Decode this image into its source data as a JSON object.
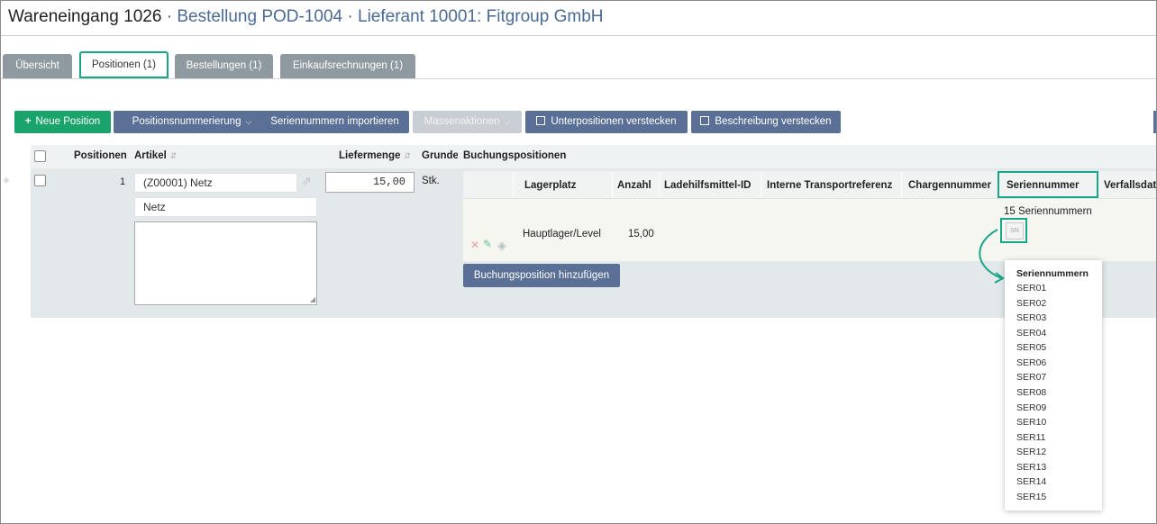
{
  "header": {
    "title_main": "Wareneingang 1026",
    "separator": "·",
    "link_order": "Bestellung POD-1004",
    "link_supplier": "Lieferant 10001: Fitgroup GmbH"
  },
  "tabs": [
    {
      "label": "Übersicht"
    },
    {
      "label": "Positionen (1)"
    },
    {
      "label": "Bestellungen (1)"
    },
    {
      "label": "Einkaufsrechnungen (1)"
    }
  ],
  "toolbar": {
    "new_position": "Neue Position",
    "numbering": "Positionsnummerierung",
    "import_serials": "Seriennummern importieren",
    "mass_actions": "Massenaktionen",
    "hide_subpositions": "Unterpositionen verstecken",
    "hide_description": "Beschreibung verstecken"
  },
  "table": {
    "headers": {
      "positions": "Positionen",
      "article": "Artikel",
      "quantity": "Liefermenge",
      "unit": "Grundeinheit",
      "bookings": "Buchungspositionen"
    },
    "row": {
      "number": "1",
      "article_value": "(Z00001) Netz",
      "article_name": "Netz",
      "quantity_value": "15,00",
      "unit": "Stk."
    }
  },
  "subtable": {
    "headers": [
      "Lagerplatz",
      "Anzahl",
      "Ladehilfsmittel-ID",
      "Interne Transportreferenz",
      "Chargennummer",
      "Seriennummer",
      "Verfallsdatum"
    ],
    "row": {
      "location": "Hauptlager/Level",
      "count": "15,00",
      "serial_summary": "15 Seriennummern",
      "serial_icon_label": "SN"
    },
    "add_button": "Buchungsposition hinzufügen"
  },
  "serial_popup": {
    "title": "Seriennummern",
    "items": [
      "SER01",
      "SER02",
      "SER03",
      "SER04",
      "SER05",
      "SER06",
      "SER07",
      "SER08",
      "SER09",
      "SER10",
      "SER11",
      "SER12",
      "SER13",
      "SER14",
      "SER15"
    ]
  },
  "colors": {
    "accent": "#17a689",
    "primary_button": "#5b7096",
    "success_button": "#1aa36a",
    "link": "#4a6a94"
  }
}
